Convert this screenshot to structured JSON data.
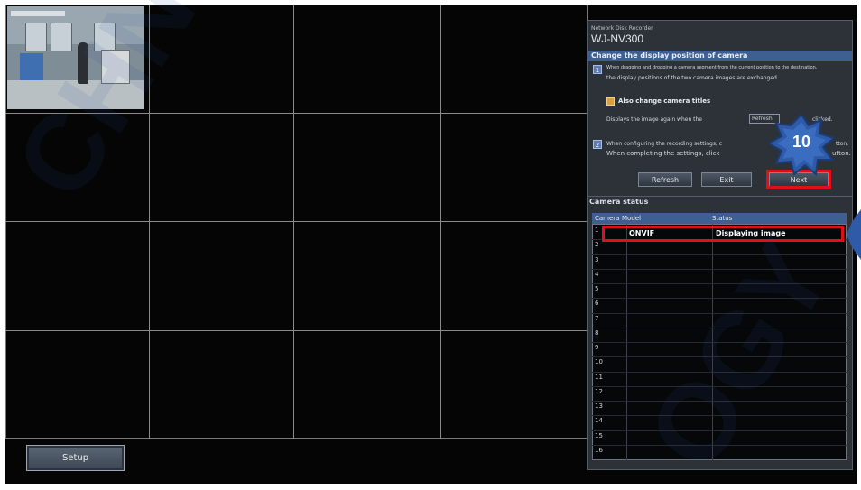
{
  "recorder": {
    "subtitle": "Network Disk Recorder",
    "model": "WJ-NV300"
  },
  "setup_button": "Setup",
  "change_position": {
    "title": "Change the display position of camera",
    "step1_icon": "1",
    "step1_line1": "When dragging and dropping a camera segment from the current position to the destination,",
    "step1_line2": "the display positions of the two camera images are exchanged.",
    "checkbox_label": "Also change camera titles",
    "desc_before": "Displays the image again when the",
    "refresh_inline": "Refresh",
    "desc_after": "clicked.",
    "step2_icon": "2",
    "step2_line1": "When configuring the recording settings, c",
    "step2_line1_end": "tton.",
    "step2_line2": "When completing the settings, click",
    "step2_line2_end": "utton."
  },
  "buttons": {
    "refresh": "Refresh",
    "exit": "Exit",
    "next": "Next"
  },
  "callout_number": "10",
  "camera_status": {
    "title": "Camera status",
    "col_camera": "Camera",
    "col_model": "Model",
    "col_status": "Status",
    "rows": [
      {
        "n": "1",
        "model": "ONVIF",
        "status": "Displaying image"
      },
      {
        "n": "2"
      },
      {
        "n": "3"
      },
      {
        "n": "4"
      },
      {
        "n": "5"
      },
      {
        "n": "6"
      },
      {
        "n": "7"
      },
      {
        "n": "8"
      },
      {
        "n": "9"
      },
      {
        "n": "10"
      },
      {
        "n": "11"
      },
      {
        "n": "12"
      },
      {
        "n": "13"
      },
      {
        "n": "14"
      },
      {
        "n": "15"
      },
      {
        "n": "16"
      }
    ]
  },
  "watermark_left": "CHNOLO",
  "watermark_right": "OGY",
  "colors": {
    "highlight": "#e0101a",
    "section_bar": "#3f5f92",
    "badge": "#2e5aa8"
  }
}
